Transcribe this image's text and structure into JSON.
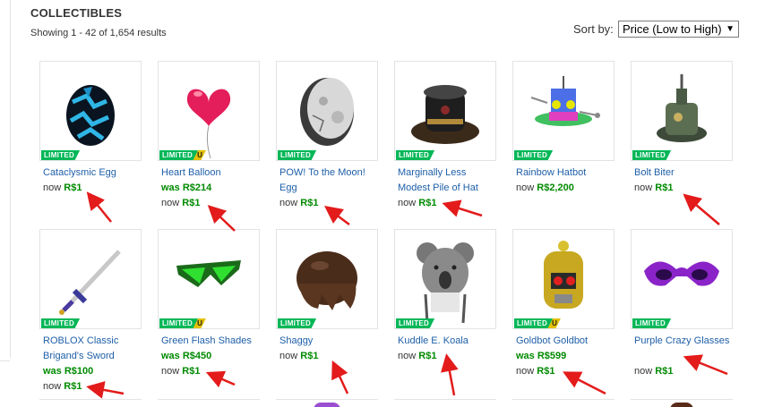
{
  "header": {
    "title": "COLLECTIBLES",
    "results": "Showing 1 - 42 of 1,654 results",
    "sort_label": "Sort by:",
    "sort_value": "Price (Low to High)"
  },
  "currency": "R$",
  "colors": {
    "limited": "#02b757",
    "unique": "#e3c000",
    "link": "#1e5fa8",
    "price": "#008a00",
    "arrow": "#e31b1b"
  },
  "items": [
    {
      "name": "Cataclysmic Egg",
      "badge": "LIMITED",
      "unique": "",
      "was": "",
      "now": "1",
      "icon": "cracked-egg-icon"
    },
    {
      "name": "Heart Balloon",
      "badge": "LIMITED",
      "unique": "U",
      "was": "214",
      "now": "1",
      "icon": "heart-balloon-icon"
    },
    {
      "name": "POW! To the Moon! Egg",
      "badge": "LIMITED",
      "unique": "",
      "was": "",
      "now": "1",
      "icon": "moon-egg-icon"
    },
    {
      "name": "Marginally Less Modest Pile of Hat",
      "badge": "LIMITED",
      "unique": "",
      "was": "",
      "now": "1",
      "icon": "hat-pile-icon"
    },
    {
      "name": "Rainbow Hatbot",
      "badge": "LIMITED",
      "unique": "",
      "was": "",
      "now": "2,200",
      "icon": "rainbow-hatbot-icon"
    },
    {
      "name": "Bolt Biter",
      "badge": "LIMITED",
      "unique": "",
      "was": "",
      "now": "1",
      "icon": "bolt-biter-icon"
    },
    {
      "name": "ROBLOX Classic Brigand's Sword",
      "badge": "LIMITED",
      "unique": "",
      "was": "100",
      "now": "1",
      "icon": "sword-icon"
    },
    {
      "name": "Green Flash Shades",
      "badge": "LIMITED",
      "unique": "U",
      "was": "450",
      "now": "1",
      "icon": "green-shades-icon"
    },
    {
      "name": "Shaggy",
      "badge": "LIMITED",
      "unique": "",
      "was": "",
      "now": "1",
      "icon": "shaggy-hair-icon"
    },
    {
      "name": "Kuddle E. Koala",
      "badge": "LIMITED",
      "unique": "",
      "was": "",
      "now": "1",
      "icon": "koala-hat-icon"
    },
    {
      "name": "Goldbot Goldbot",
      "badge": "LIMITED",
      "unique": "U",
      "was": "599",
      "now": "1",
      "icon": "goldbot-helmet-icon"
    },
    {
      "name": "Purple Crazy Glasses",
      "badge": "LIMITED",
      "unique": "",
      "was": "",
      "now": "1",
      "icon": "purple-glasses-icon"
    }
  ],
  "labels": {
    "was": "was",
    "now": "now"
  }
}
